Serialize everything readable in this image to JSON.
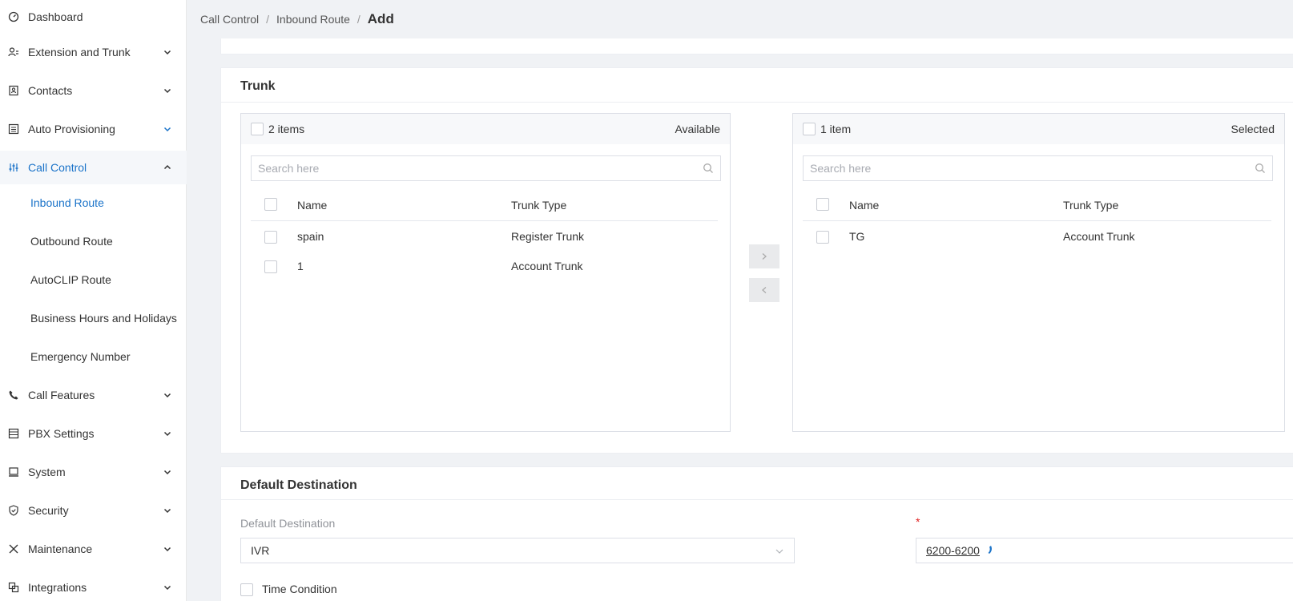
{
  "sidebar": {
    "items": [
      {
        "label": "Dashboard",
        "icon": "dashboard-icon"
      },
      {
        "label": "Extension and Trunk",
        "icon": "user-list-icon"
      },
      {
        "label": "Contacts",
        "icon": "contacts-icon"
      },
      {
        "label": "Auto Provisioning",
        "icon": "provisioning-icon"
      },
      {
        "label": "Call Control",
        "icon": "sliders-icon"
      },
      {
        "label": "Call Features",
        "icon": "phone-icon"
      },
      {
        "label": "PBX Settings",
        "icon": "settings-list-icon"
      },
      {
        "label": "System",
        "icon": "monitor-icon"
      },
      {
        "label": "Security",
        "icon": "shield-icon"
      },
      {
        "label": "Maintenance",
        "icon": "tools-icon"
      },
      {
        "label": "Integrations",
        "icon": "integrations-icon"
      }
    ],
    "call_control_sub": [
      {
        "label": "Inbound Route"
      },
      {
        "label": "Outbound Route"
      },
      {
        "label": "AutoCLIP Route"
      },
      {
        "label": "Business Hours and Holidays"
      },
      {
        "label": "Emergency Number"
      }
    ]
  },
  "breadcrumb": {
    "items": [
      "Call Control",
      "Inbound Route"
    ],
    "separator": "/",
    "current": "Add"
  },
  "trunk": {
    "title": "Trunk",
    "available": {
      "count_label": "2 items",
      "side_label": "Available",
      "search_placeholder": "Search here",
      "columns": [
        "Name",
        "Trunk Type"
      ],
      "rows": [
        {
          "name": "spain",
          "type": "Register Trunk"
        },
        {
          "name": "1",
          "type": "Account Trunk"
        }
      ]
    },
    "selected": {
      "count_label": "1 item",
      "side_label": "Selected",
      "search_placeholder": "Search here",
      "columns": [
        "Name",
        "Trunk Type"
      ],
      "rows": [
        {
          "name": "TG",
          "type": "Account Trunk"
        }
      ]
    }
  },
  "default_destination": {
    "title": "Default Destination",
    "field_label": "Default Destination",
    "select_value": "IVR",
    "required_mark": "*",
    "extension_value": "6200-6200",
    "time_condition_label": "Time Condition"
  },
  "colors": {
    "accent": "#1a73c9",
    "required": "#e02020"
  }
}
